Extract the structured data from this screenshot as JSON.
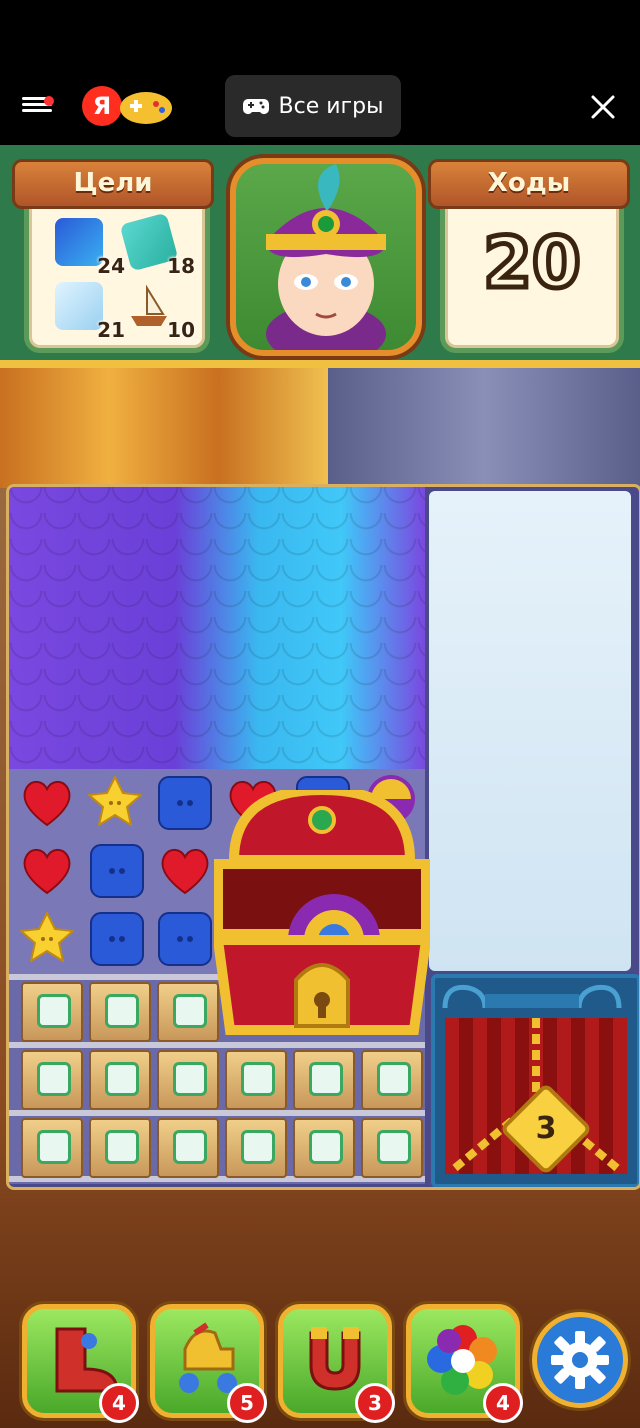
{
  "topbar": {
    "all_games_label": "Все игры",
    "ya_logo": "Я"
  },
  "goals": {
    "title": "Цели",
    "items": [
      {
        "icon": "blue-scales-tile-icon",
        "count": "24"
      },
      {
        "icon": "teal-note-tile-icon",
        "count": "18"
      },
      {
        "icon": "ice-tile-icon",
        "count": "21"
      },
      {
        "icon": "toy-ship-icon",
        "count": "10"
      }
    ]
  },
  "moves": {
    "title": "Ходы",
    "value": "20"
  },
  "cage": {
    "lock_count": "3"
  },
  "boosters": [
    {
      "icon": "boot-icon",
      "count": "4"
    },
    {
      "icon": "rocking-horse-icon",
      "count": "5"
    },
    {
      "icon": "magnet-icon",
      "count": "3"
    },
    {
      "icon": "rainbow-flower-icon",
      "count": "4"
    }
  ]
}
